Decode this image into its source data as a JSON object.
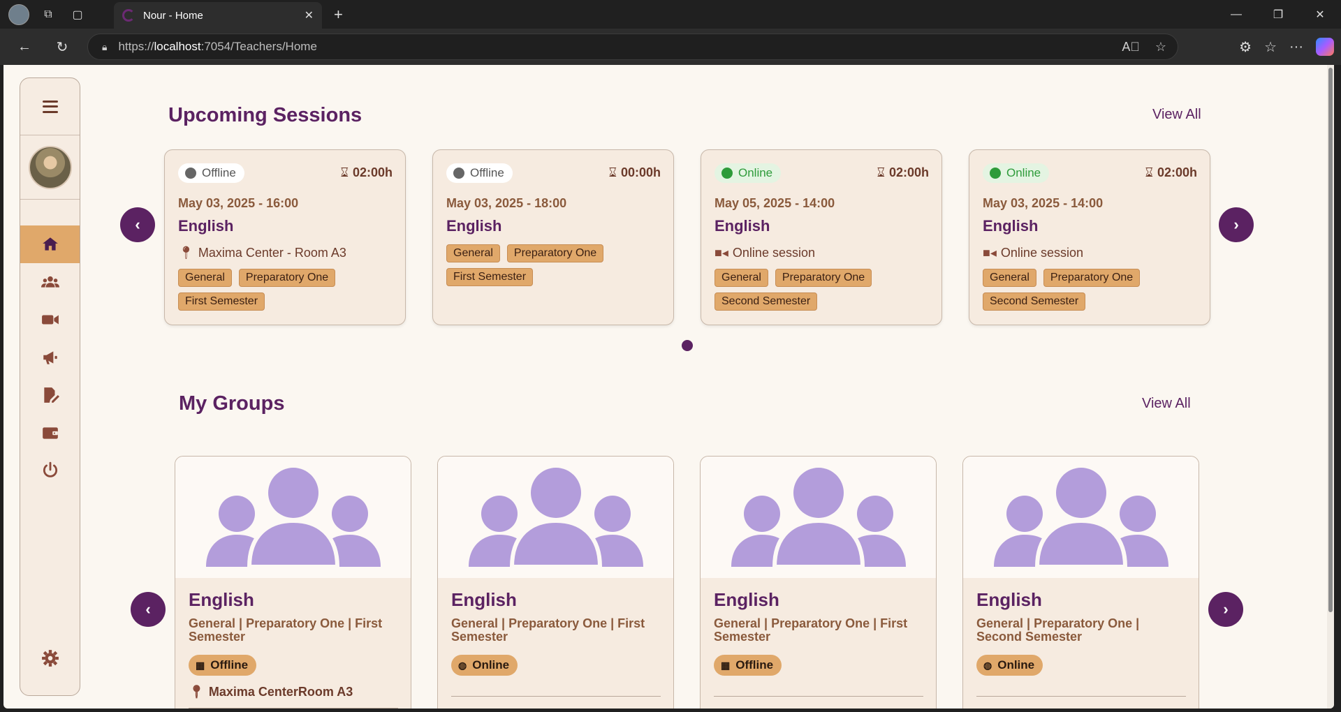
{
  "browser": {
    "tab_title": "Nour - Home",
    "url_prefix": "https://",
    "url_host": "localhost",
    "url_rest": ":7054/Teachers/Home"
  },
  "sidebar": {
    "items": [
      {
        "icon": "home-icon",
        "active": true
      },
      {
        "icon": "users-icon",
        "active": false
      },
      {
        "icon": "video-icon",
        "active": false
      },
      {
        "icon": "megaphone-icon",
        "active": false
      },
      {
        "icon": "edit-file-icon",
        "active": false
      },
      {
        "icon": "wallet-icon",
        "active": false
      },
      {
        "icon": "power-icon",
        "active": false
      }
    ],
    "settings_icon": "gear-icon"
  },
  "upcoming": {
    "title": "Upcoming Sessions",
    "view_all": "View All",
    "sessions": [
      {
        "mode": "Offline",
        "duration": "02:00h",
        "date": "May 03, 2025 - 16:00",
        "subject": "English",
        "location": "Maxima Center - Room A3",
        "tags": [
          "General",
          "Preparatory One",
          "First Semester"
        ]
      },
      {
        "mode": "Offline",
        "duration": "00:00h",
        "date": "May 03, 2025 - 18:00",
        "subject": "English",
        "location": "",
        "tags": [
          "General",
          "Preparatory One",
          "First Semester"
        ]
      },
      {
        "mode": "Online",
        "duration": "02:00h",
        "date": "May 05, 2025 - 14:00",
        "subject": "English",
        "location": "Online session",
        "tags": [
          "General",
          "Preparatory One",
          "Second Semester"
        ]
      },
      {
        "mode": "Online",
        "duration": "02:00h",
        "date": "May 03, 2025 - 14:00",
        "subject": "English",
        "location": "Online session",
        "tags": [
          "General",
          "Preparatory One",
          "Second Semester"
        ]
      }
    ]
  },
  "groups": {
    "title": "My Groups",
    "view_all": "View All",
    "items": [
      {
        "subject": "English",
        "desc": "General | Preparatory One | First Semester",
        "mode": "Offline",
        "location": "Maxima CenterRoom A3"
      },
      {
        "subject": "English",
        "desc": "General | Preparatory One | First Semester",
        "mode": "Online",
        "location": ""
      },
      {
        "subject": "English",
        "desc": "General | Preparatory One | First Semester",
        "mode": "Offline",
        "location": ""
      },
      {
        "subject": "English",
        "desc": "General | Preparatory One | Second Semester",
        "mode": "Online",
        "location": ""
      }
    ]
  },
  "colors": {
    "accent": "#5b2262",
    "tag": "#e0a86a",
    "online": "#2e9b3a",
    "group_icon": "#b39ddb"
  }
}
